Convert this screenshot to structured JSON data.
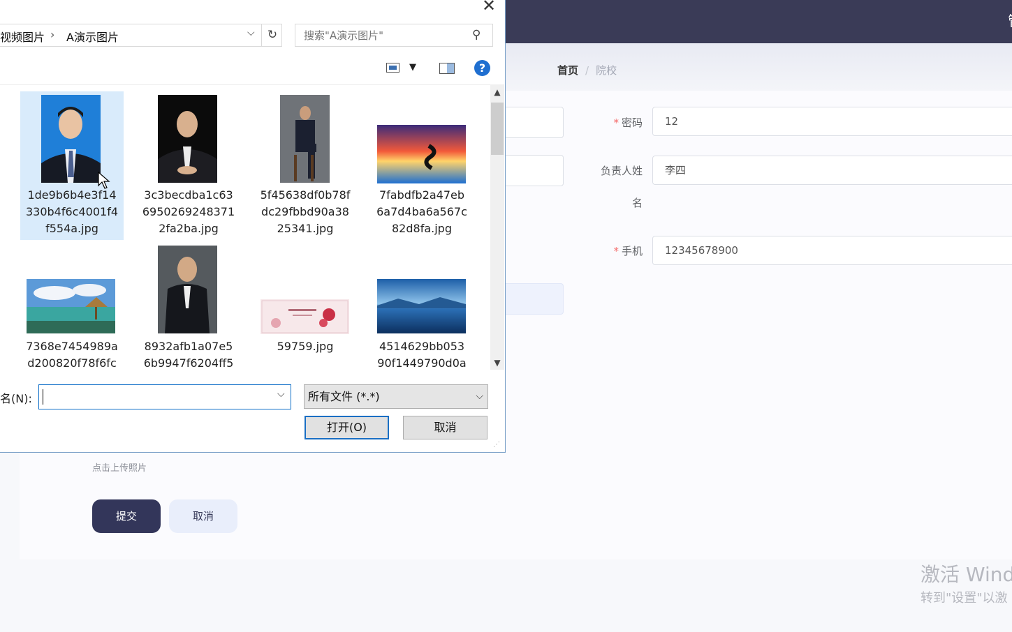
{
  "app": {
    "breadcrumb": {
      "home": "首页",
      "separator": "/",
      "current": "院校"
    },
    "form": {
      "password_label": "密码",
      "password_value": "12",
      "owner_label_line1": "负责人姓",
      "owner_label_line2": "名",
      "owner_value": "李四",
      "phone_label": "手机",
      "phone_value": "12345678900",
      "upload_hint": "点击上传照片",
      "submit_label": "提交",
      "cancel_label": "取消"
    },
    "watermark": {
      "line1": "激活 Wind",
      "line2": "转到\"设置\"以激"
    }
  },
  "dialog": {
    "path": [
      "视频图片",
      "A演示图片"
    ],
    "search_placeholder": "搜索\"A演示图片\"",
    "files": [
      {
        "name_lines": [
          "1de9b6b4e3f14",
          "330b4f6c4001f4",
          "f554a.jpg"
        ],
        "selected": true
      },
      {
        "name_lines": [
          "3c3becdba1c63",
          "6950269248371",
          "2fa2ba.jpg"
        ],
        "selected": false
      },
      {
        "name_lines": [
          "5f45638df0b78f",
          "dc29fbbd90a38",
          "25341.jpg"
        ],
        "selected": false
      },
      {
        "name_lines": [
          "7fabdfb2a47eb",
          "6a7d4ba6a567c",
          "82d8fa.jpg"
        ],
        "selected": false
      },
      {
        "name_lines": [
          "7368e7454989a",
          "d200820f78f6fc"
        ],
        "selected": false
      },
      {
        "name_lines": [
          "8932afb1a07e5",
          "6b9947f6204ff5"
        ],
        "selected": false
      },
      {
        "name_lines": [
          "59759.jpg"
        ],
        "selected": false
      },
      {
        "name_lines": [
          "4514629bb053",
          "90f1449790d0a"
        ],
        "selected": false
      }
    ],
    "filename_label": "名(N):",
    "filename_value": "",
    "filetype_value": "所有文件 (*.*)",
    "open_label": "打开(O)",
    "cancel_label": "取消"
  },
  "icons": {
    "close": "close-icon",
    "refresh": "refresh-icon",
    "search": "search-icon",
    "help": "help-icon"
  }
}
